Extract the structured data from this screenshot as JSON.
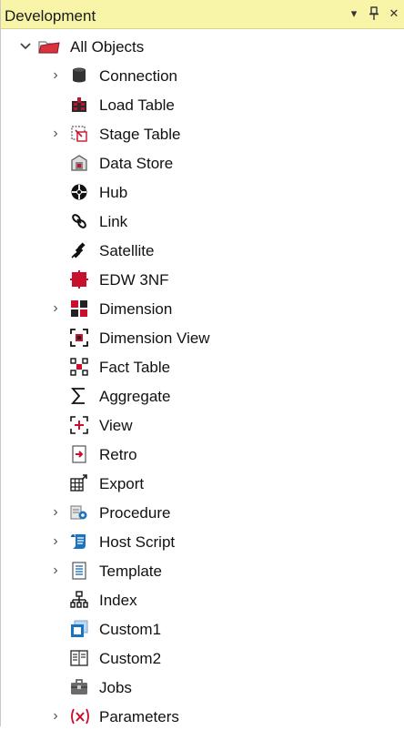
{
  "panel": {
    "title": "Development",
    "buttons": {
      "dropdown": "▾",
      "pin": "📌",
      "close": "✕"
    }
  },
  "tree": {
    "root": {
      "label": "All Objects",
      "expanded": true
    },
    "items": [
      {
        "label": "Connection",
        "icon": "connection-icon",
        "expandable": true
      },
      {
        "label": "Load Table",
        "icon": "load-table-icon",
        "expandable": false
      },
      {
        "label": "Stage Table",
        "icon": "stage-table-icon",
        "expandable": true
      },
      {
        "label": "Data Store",
        "icon": "data-store-icon",
        "expandable": false
      },
      {
        "label": "Hub",
        "icon": "hub-icon",
        "expandable": false
      },
      {
        "label": "Link",
        "icon": "link-icon",
        "expandable": false
      },
      {
        "label": "Satellite",
        "icon": "satellite-icon",
        "expandable": false
      },
      {
        "label": "EDW 3NF",
        "icon": "edw-3nf-icon",
        "expandable": false
      },
      {
        "label": "Dimension",
        "icon": "dimension-icon",
        "expandable": true
      },
      {
        "label": "Dimension View",
        "icon": "dimension-view-icon",
        "expandable": false
      },
      {
        "label": "Fact Table",
        "icon": "fact-table-icon",
        "expandable": false
      },
      {
        "label": "Aggregate",
        "icon": "aggregate-icon",
        "expandable": false
      },
      {
        "label": "View",
        "icon": "view-icon",
        "expandable": false
      },
      {
        "label": "Retro",
        "icon": "retro-icon",
        "expandable": false
      },
      {
        "label": "Export",
        "icon": "export-icon",
        "expandable": false
      },
      {
        "label": "Procedure",
        "icon": "procedure-icon",
        "expandable": true
      },
      {
        "label": "Host Script",
        "icon": "host-script-icon",
        "expandable": true
      },
      {
        "label": "Template",
        "icon": "template-icon",
        "expandable": true
      },
      {
        "label": "Index",
        "icon": "index-icon",
        "expandable": false
      },
      {
        "label": "Custom1",
        "icon": "custom1-icon",
        "expandable": false
      },
      {
        "label": "Custom2",
        "icon": "custom2-icon",
        "expandable": false
      },
      {
        "label": "Jobs",
        "icon": "jobs-icon",
        "expandable": false
      },
      {
        "label": "Parameters",
        "icon": "parameters-icon",
        "expandable": true
      }
    ]
  },
  "colors": {
    "titlebar_bg": "#f8f5a8",
    "accent_red": "#c8102e",
    "accent_blue": "#1e73be",
    "dark": "#2b2b2b"
  }
}
